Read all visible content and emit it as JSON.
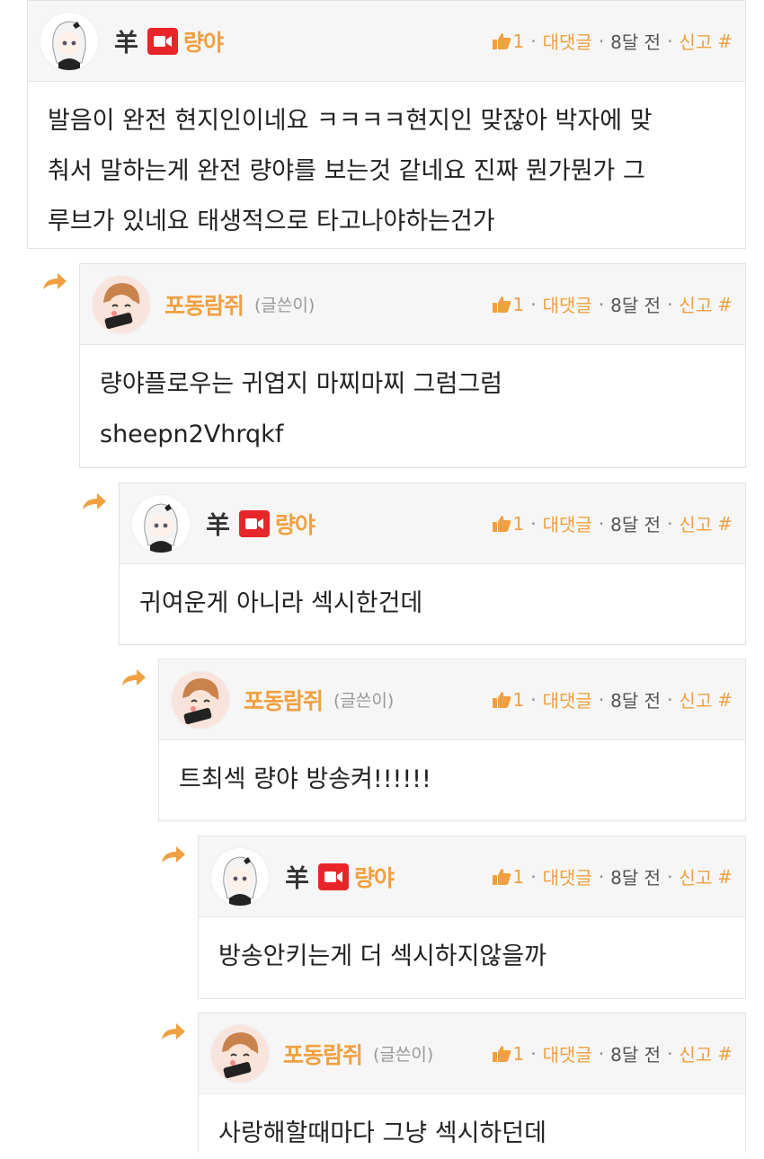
{
  "comments": [
    {
      "author": "량야",
      "badge": "羊",
      "writer": "",
      "likes": "1",
      "reply": "대댓글",
      "time": "8달 전",
      "report": "신고",
      "hash": "#",
      "text": [
        "발음이 완전 현지인이네요 ㅋㅋㅋㅋ현지인 맞잖아 박자에 맞",
        "춰서 말하는게 완전 량야를 보는것 같네요 진짜 뭔가뭔가 그",
        "루브가 있네요 태생적으로 타고나야하는건가"
      ]
    },
    {
      "author": "포동람쥐",
      "badge": "",
      "writer": "(글쓴이)",
      "likes": "1",
      "reply": "대댓글",
      "time": "8달 전",
      "report": "신고",
      "hash": "#",
      "text": [
        "량야플로우는 귀엽지 마찌마찌 그럼그럼",
        "sheepn2Vhrqkf"
      ]
    },
    {
      "author": "량야",
      "badge": "羊",
      "writer": "",
      "likes": "1",
      "reply": "대댓글",
      "time": "8달 전",
      "report": "신고",
      "hash": "#",
      "text": [
        "귀여운게 아니라 섹시한건데"
      ]
    },
    {
      "author": "포동람쥐",
      "badge": "",
      "writer": "(글쓴이)",
      "likes": "1",
      "reply": "대댓글",
      "time": "8달 전",
      "report": "신고",
      "hash": "#",
      "text": [
        "트최섹 량야 방송켜!!!!!!"
      ]
    },
    {
      "author": "량야",
      "badge": "羊",
      "writer": "",
      "likes": "1",
      "reply": "대댓글",
      "time": "8달 전",
      "report": "신고",
      "hash": "#",
      "text": [
        "방송안키는게 더 섹시하지않을까"
      ]
    },
    {
      "author": "포동람쥐",
      "badge": "",
      "writer": "(글쓴이)",
      "likes": "1",
      "reply": "대댓글",
      "time": "8달 전",
      "report": "신고",
      "hash": "#",
      "text": [
        "사랑해할때마다 그냥 섹시하던데"
      ]
    }
  ],
  "colors": {
    "accent": "#f0a040",
    "broadcast": "#e8262a",
    "header_bg": "#f6f6f6"
  },
  "icons": [
    "reply-arrow-icon",
    "thumbs-up-icon",
    "broadcast-camera-icon",
    "sheep-badge-icon"
  ]
}
